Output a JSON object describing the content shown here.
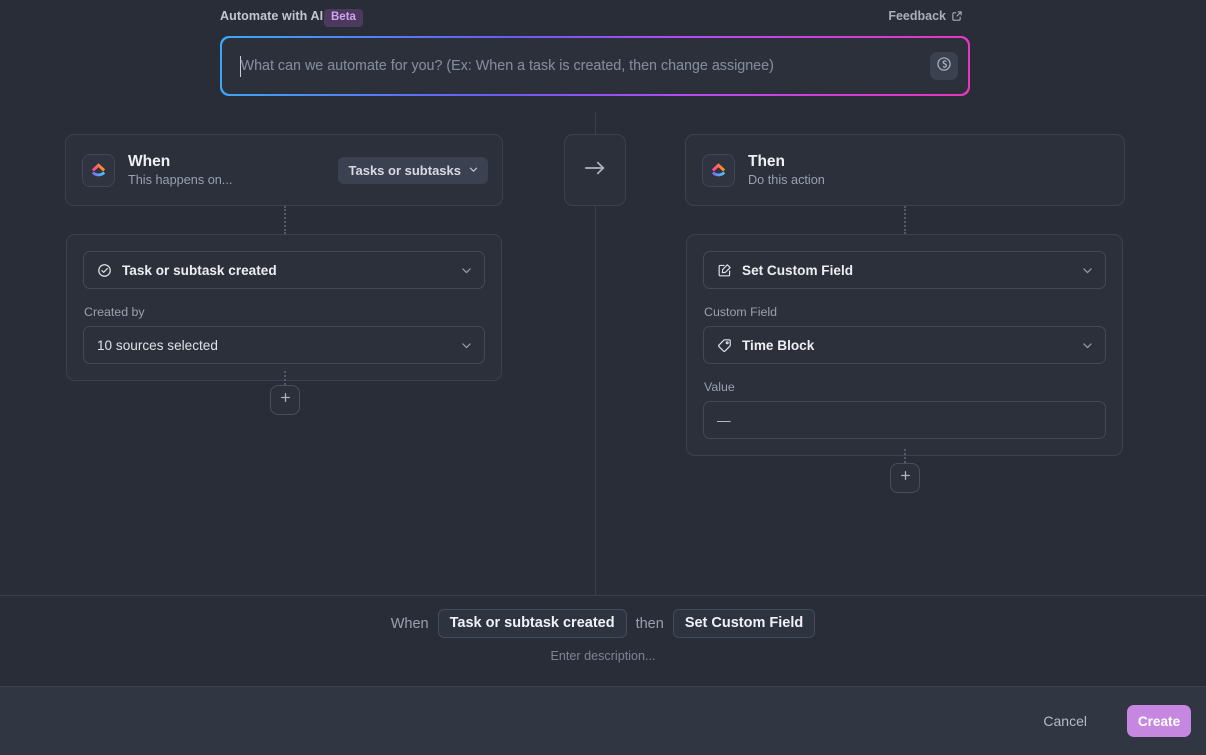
{
  "ai_bar": {
    "label": "Automate with AI",
    "badge": "Beta",
    "feedback": "Feedback",
    "feedback_icon": "external-link-icon",
    "input_value": "",
    "input_placeholder": "What can we automate for you? (Ex: When a task is created, then change assignee)",
    "submit_icon": "ai-sparkle-icon"
  },
  "when_card": {
    "logo_icon": "clickup-logo-icon",
    "title": "When",
    "subtitle": "This happens on...",
    "scope_label": "Tasks or subtasks",
    "scope_chevron_icon": "chevron-down-icon"
  },
  "then_card": {
    "logo_icon": "clickup-logo-icon",
    "title": "Then",
    "subtitle": "Do this action"
  },
  "connector": {
    "arrow_icon": "arrow-right-icon",
    "add_icon": "plus-icon"
  },
  "trigger": {
    "select_icon": "check-circle-icon",
    "select_label": "Task or subtask created",
    "chevron_icon": "chevron-down-icon",
    "field_label": "Created by",
    "field_value": "10 sources selected",
    "field_chevron_icon": "chevron-down-icon"
  },
  "action": {
    "select_icon": "edit-square-icon",
    "select_label": "Set Custom Field",
    "chevron_icon": "chevron-down-icon",
    "custom_field_label": "Custom Field",
    "custom_field_icon": "tag-icon",
    "custom_field_value": "Time Block",
    "custom_field_chevron_icon": "chevron-down-icon",
    "value_label": "Value",
    "value_text": "—"
  },
  "summary": {
    "when_word": "When",
    "trigger_chip": "Task or subtask created",
    "then_word": "then",
    "action_chip": "Set Custom Field",
    "description_placeholder": "Enter description..."
  },
  "footer": {
    "cancel_label": "Cancel",
    "create_label": "Create"
  },
  "colors": {
    "page_bg": "#292d38",
    "card_bg": "#2b303b",
    "footer_bg": "#313643",
    "border": "#3b4150",
    "accent_create": "#c687e0",
    "beta_bg": "#4b3a5d",
    "beta_text": "#cfa3f0",
    "gradient_start": "#3ba8f5",
    "gradient_mid": "#b34cf0",
    "gradient_end": "#e836bf"
  }
}
